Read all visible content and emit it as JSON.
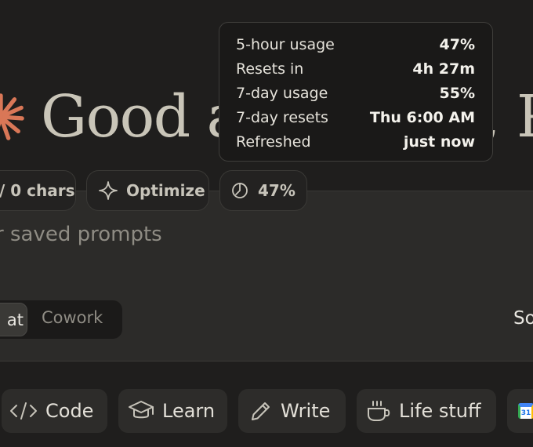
{
  "greeting": {
    "text": "Good afternoon, Paul"
  },
  "toolbar_pills": {
    "chars_label": "/ 0 chars",
    "optimize_label": "Optimize",
    "usage_label": "47%"
  },
  "composer": {
    "placeholder": "r saved prompts"
  },
  "mode_toggle": {
    "chat_label": "at",
    "cowork_label": "Cowork"
  },
  "right_label": "So",
  "chips": [
    {
      "label": "Code",
      "icon": "code-icon"
    },
    {
      "label": "Learn",
      "icon": "graduation-cap-icon"
    },
    {
      "label": "Write",
      "icon": "pencil-icon"
    },
    {
      "label": "Life stuff",
      "icon": "coffee-cup-icon"
    },
    {
      "label": "",
      "icon": "calendar-app-icon"
    }
  ],
  "calendar_icon_text": "31",
  "usage_tooltip": {
    "rows": [
      {
        "label": "5-hour usage",
        "value": "47%"
      },
      {
        "label": "Resets in",
        "value": "4h 27m"
      },
      {
        "label": "7-day usage",
        "value": "55%"
      },
      {
        "label": "7-day resets",
        "value": "Thu 6:00 AM"
      },
      {
        "label": "Refreshed",
        "value": "just now"
      }
    ]
  },
  "colors": {
    "background": "#1f1e1d",
    "composer": "#2c2b29",
    "accent_logo": "#d97757",
    "greeting_text": "#c9c5b8"
  }
}
